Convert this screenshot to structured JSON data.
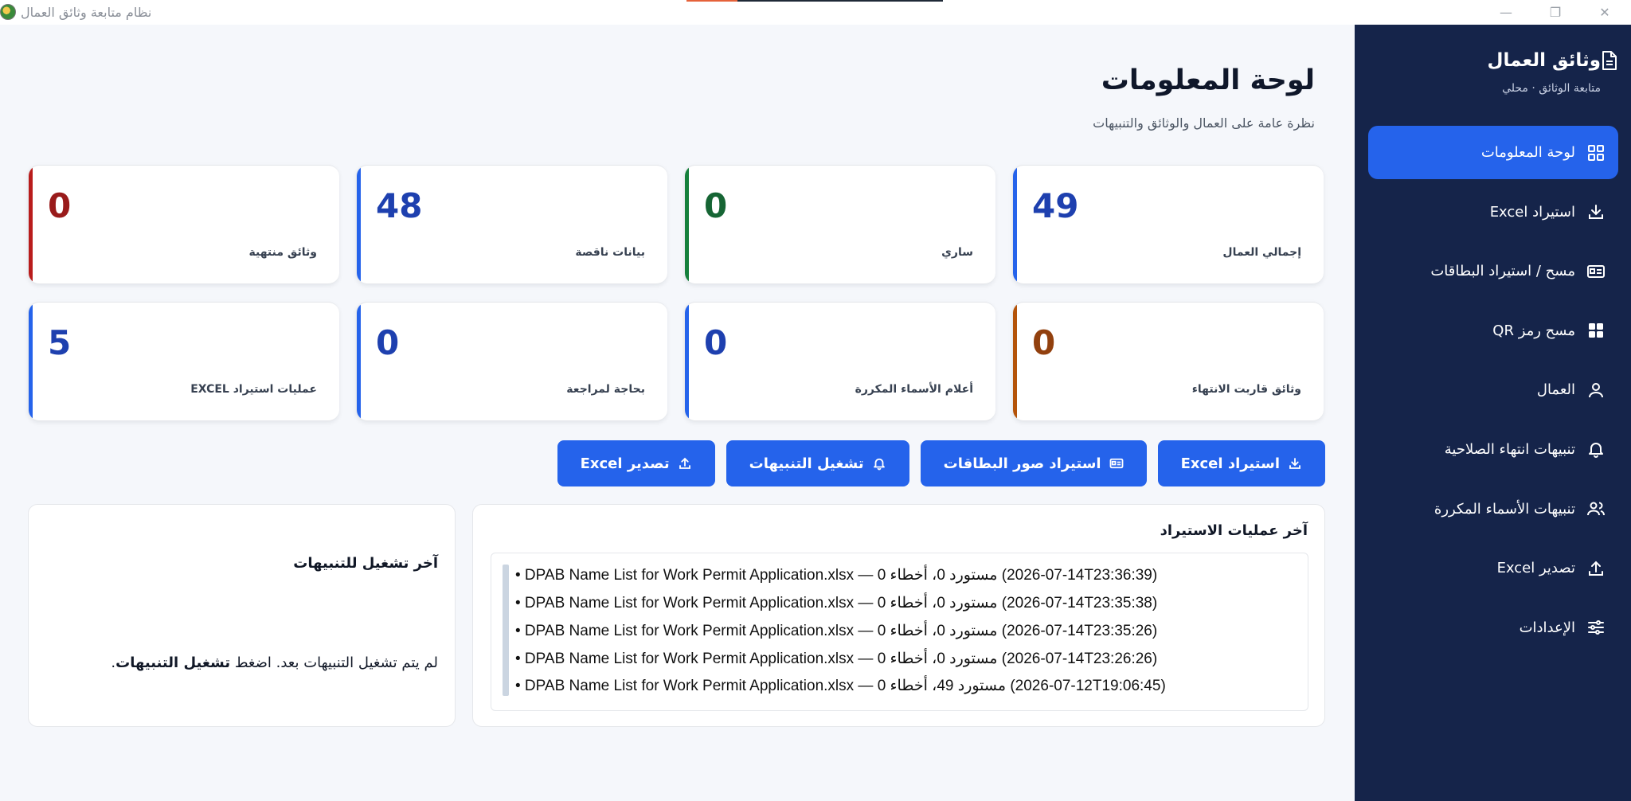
{
  "window": {
    "title": "نظام متابعة وثائق العمال",
    "progress": 0.2,
    "controls": {
      "minimize": "—",
      "maximize": "❐",
      "close": "✕"
    }
  },
  "sidebar": {
    "title": "وثائق العمال",
    "subtitle": "متابعة الوثائق · محلي",
    "items": [
      {
        "label": "لوحة المعلومات",
        "icon": "grid-icon",
        "active": true
      },
      {
        "label": "استيراد Excel",
        "icon": "download-icon",
        "active": false
      },
      {
        "label": "مسح / استيراد البطاقات",
        "icon": "id-card-icon",
        "active": false
      },
      {
        "label": "مسح رمز QR",
        "icon": "qr-icon",
        "active": false
      },
      {
        "label": "العمال",
        "icon": "user-icon",
        "active": false
      },
      {
        "label": "تنبيهات انتهاء الصلاحية",
        "icon": "bell-icon",
        "active": false
      },
      {
        "label": "تنبيهات الأسماء المكررة",
        "icon": "users-icon",
        "active": false
      },
      {
        "label": "تصدير Excel",
        "icon": "upload-icon",
        "active": false
      },
      {
        "label": "الإعدادات",
        "icon": "sliders-icon",
        "active": false
      }
    ]
  },
  "main": {
    "title": "لوحة المعلومات",
    "subtitle": "نظرة عامة على العمال والوثائق والتنبيهات"
  },
  "stats": [
    {
      "label": "إجمالي العمال",
      "value": "49",
      "accent": "#2563eb",
      "number_color": "#1e40af"
    },
    {
      "label": "ساري",
      "value": "0",
      "accent": "#16803c",
      "number_color": "#166534"
    },
    {
      "label": "بيانات ناقصة",
      "value": "48",
      "accent": "#2563eb",
      "number_color": "#1e40af"
    },
    {
      "label": "وثائق منتهية",
      "value": "0",
      "accent": "#b91c1c",
      "number_color": "#991b1b"
    },
    {
      "label": "وثائق قاربت الانتهاء",
      "value": "0",
      "accent": "#b45309",
      "number_color": "#92400e"
    },
    {
      "label": "أعلام الأسماء المكررة",
      "value": "0",
      "accent": "#2563eb",
      "number_color": "#1e40af"
    },
    {
      "label": "بحاجة لمراجعة",
      "value": "0",
      "accent": "#2563eb",
      "number_color": "#1e40af"
    },
    {
      "label": "عمليات استيراد EXCEL",
      "value": "5",
      "accent": "#2563eb",
      "number_color": "#1e40af"
    }
  ],
  "actions": [
    {
      "label": "استيراد Excel",
      "icon": "download-icon"
    },
    {
      "label": "استيراد صور البطاقات",
      "icon": "id-card-icon"
    },
    {
      "label": "تشغيل التنبيهات",
      "icon": "bell-icon"
    },
    {
      "label": "تصدير Excel",
      "icon": "upload-icon"
    }
  ],
  "imports": {
    "title": "آخر عمليات الاستيراد",
    "rows": [
      "• DPAB Name List for Work Permit Application.xlsx  —  مستورد 0، أخطاء 0  (14-07-2026T23:36:39)",
      "• DPAB Name List for Work Permit Application.xlsx  —  مستورد 0، أخطاء 0  (14-07-2026T23:35:38)",
      "• DPAB Name List for Work Permit Application.xlsx  —  مستورد 0، أخطاء 0  (14-07-2026T23:35:26)",
      "• DPAB Name List for Work Permit Application.xlsx  —  مستورد 0، أخطاء 0  (14-07-2026T23:26:26)",
      "• DPAB Name List for Work Permit Application.xlsx  —  مستورد 49، أخطاء 0  (12-07-2026T19:06:45)"
    ]
  },
  "alerts": {
    "title": "آخر تشغيل للتنبيهات",
    "text": "لم يتم تشغيل التنبيهات بعد. اضغط",
    "emphasis": "تشغيل التنبيهات",
    "suffix": "."
  }
}
